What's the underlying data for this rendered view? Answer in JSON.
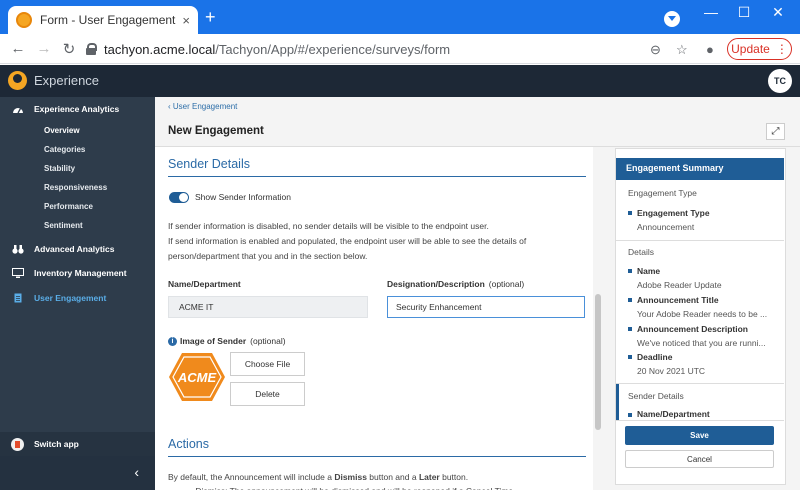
{
  "browser": {
    "tab_title": "Form - User Engagement - Expe",
    "tab_close": "×",
    "new_tab": "+",
    "url_host": "tachyon.acme.local",
    "url_path": "/Tachyon/App/#/experience/surveys/form",
    "update_label": "Update",
    "update_dots": "⋮",
    "nav_back": "←",
    "nav_forward": "→",
    "nav_reload": "↻",
    "win_min": "—",
    "win_max": "☐",
    "win_close": "✕",
    "zoom_glyph": "⊖",
    "star_glyph": "☆",
    "profile_glyph": "●"
  },
  "app": {
    "title": "Experience",
    "avatar_initials": "TC"
  },
  "sidebar": {
    "sections": [
      {
        "label": "Experience Analytics",
        "icon": "gauge-icon"
      },
      {
        "label": "Advanced Analytics",
        "icon": "binoculars-icon"
      },
      {
        "label": "Inventory Management",
        "icon": "monitor-icon"
      },
      {
        "label": "User Engagement",
        "icon": "clipboard-icon"
      }
    ],
    "sub_items": [
      "Overview",
      "Categories",
      "Stability",
      "Responsiveness",
      "Performance",
      "Sentiment"
    ],
    "switch_app": "Switch app",
    "collapse_glyph": "‹"
  },
  "page": {
    "breadcrumb": "‹ User Engagement",
    "title": "New Engagement",
    "expand_glyph": "⤢"
  },
  "form": {
    "sender_heading": "Sender Details",
    "toggle_label": "Show Sender Information",
    "toggle_on": true,
    "info_line1": "If sender information is disabled, no sender details will be visible to the endpoint user.",
    "info_line2": "If send information is enabled and populated, the endpoint user will be able to see the details of",
    "info_line3": "person/department that you and in the section below.",
    "name_label": "Name/Department",
    "name_value": "ACME IT",
    "desig_label": "Designation/Description",
    "desig_optional": "(optional)",
    "desig_value": "Security Enhancement",
    "image_label": "Image of Sender",
    "image_optional": "(optional)",
    "image_info": "i",
    "logo_text": "ACME",
    "choose_file": "Choose File",
    "delete": "Delete",
    "actions_heading": "Actions",
    "actions_text_pre": "By default, the Announcement will include a ",
    "actions_dismiss": "Dismiss",
    "actions_text_mid": " button and a ",
    "actions_later": "Later",
    "actions_text_post": " button.",
    "cut_text": "• Dismiss: The announcement will be dismissed and will be reopened if a Cancel Time"
  },
  "summary": {
    "heading": "Engagement Summary",
    "type_group": "Engagement Type",
    "type_key": "Engagement Type",
    "type_value": "Announcement",
    "details_group": "Details",
    "name_key": "Name",
    "name_value": "Adobe Reader Update",
    "ann_title_key": "Announcement Title",
    "ann_title_value": "Your Adobe Reader needs to be ...",
    "ann_desc_key": "Announcement Description",
    "ann_desc_value": "We've noticed that you are runni...",
    "deadline_key": "Deadline",
    "deadline_value": "20 Nov 2021 UTC",
    "sender_group": "Sender Details",
    "sender_key": "Name/Department",
    "save": "Save",
    "cancel": "Cancel"
  },
  "colors": {
    "chrome_blue": "#1a73e8",
    "app_header": "#1d2836",
    "sidebar": "#2e3c4b",
    "accent_blue": "#1f5d96",
    "logo_orange": "#f08a1c"
  }
}
